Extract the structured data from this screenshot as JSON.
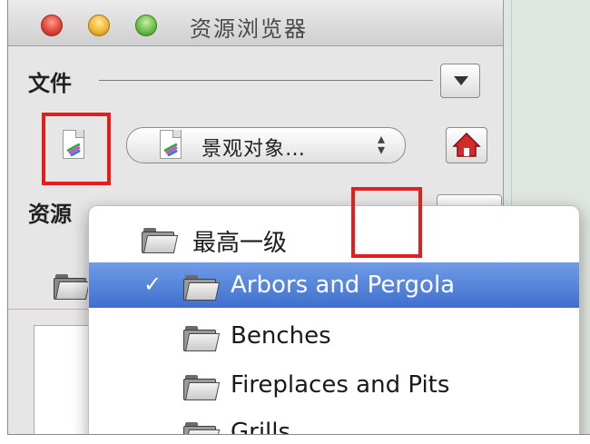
{
  "window": {
    "title": "资源浏览器"
  },
  "file_section": {
    "label": "文件"
  },
  "model_select": {
    "value": "景观对象…"
  },
  "resources_section": {
    "label": "资源"
  },
  "dropdown": {
    "items": [
      {
        "label": "最高一级",
        "checked": false,
        "selected": false
      },
      {
        "label": "Arbors and Pergola",
        "checked": true,
        "selected": true
      },
      {
        "label": "Benches",
        "checked": false,
        "selected": false
      },
      {
        "label": "Fireplaces and Pits",
        "checked": false,
        "selected": false
      },
      {
        "label": "Grills",
        "checked": false,
        "selected": false
      }
    ],
    "check_glyph": "✓"
  },
  "colors": {
    "highlight": "#4a78d4",
    "annotation": "#e41d1d"
  },
  "icons": [
    "close-icon",
    "minimize-icon",
    "zoom-icon",
    "menu-arrow-icon",
    "document-icon",
    "home-icon",
    "folder-icon"
  ]
}
